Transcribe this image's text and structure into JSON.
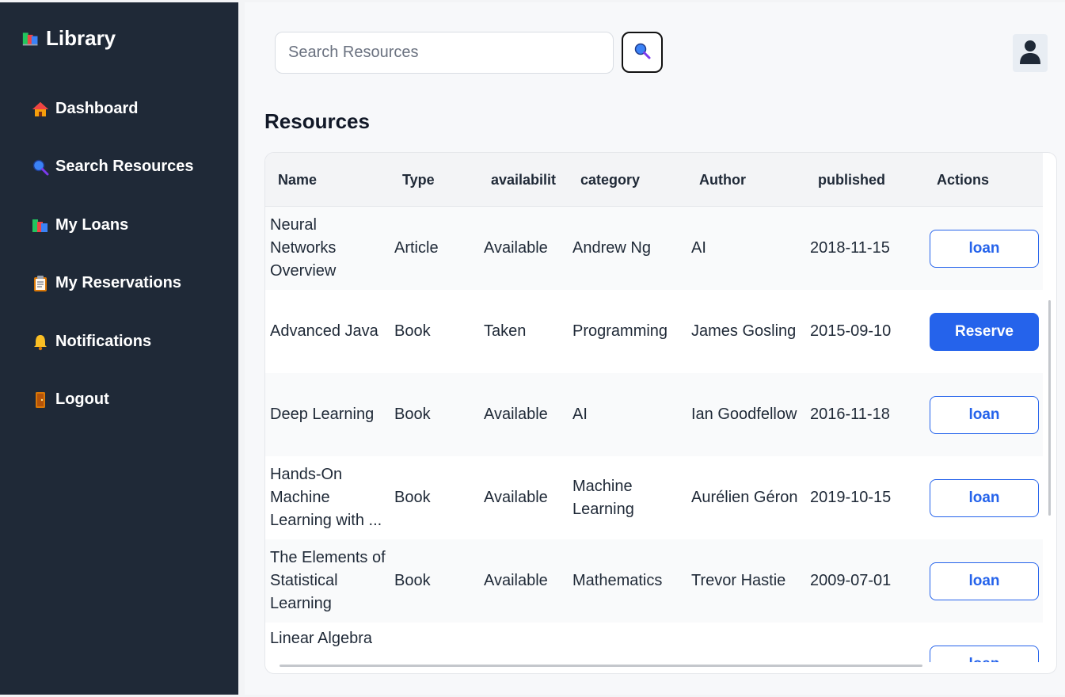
{
  "app": {
    "brand": "Library",
    "brand_icon": "books-icon"
  },
  "nav": [
    {
      "label": "Dashboard",
      "icon": "house-icon"
    },
    {
      "label": "Search Resources",
      "icon": "magnifier-icon"
    },
    {
      "label": "My Loans",
      "icon": "books-icon"
    },
    {
      "label": "My Reservations",
      "icon": "clipboard-icon"
    },
    {
      "label": "Notifications",
      "icon": "bell-icon"
    },
    {
      "label": "Logout",
      "icon": "door-icon"
    }
  ],
  "search": {
    "placeholder": "Search Resources",
    "value": ""
  },
  "page_title": "Resources",
  "table": {
    "columns": [
      "Name",
      "Type",
      "availabilit",
      "category",
      "Author",
      "published",
      "Actions"
    ],
    "rows": [
      {
        "name": [
          "Neural",
          "Networks",
          "Overview"
        ],
        "type": "Article",
        "availability": "Available",
        "category": [
          "Andrew Ng"
        ],
        "author": "AI",
        "published": "2018-11-15",
        "action": "loan"
      },
      {
        "name": [
          "Advanced Java"
        ],
        "type": "Book",
        "availability": "Taken",
        "category": [
          "Programming"
        ],
        "author": "James Gosling",
        "published": "2015-09-10",
        "action": "Reserve"
      },
      {
        "name": [
          "Deep Learning"
        ],
        "type": "Book",
        "availability": "Available",
        "category": [
          "AI"
        ],
        "author": "Ian Goodfellow",
        "published": "2016-11-18",
        "action": "loan"
      },
      {
        "name": [
          "Hands-On",
          "Machine",
          "Learning with ..."
        ],
        "type": "Book",
        "availability": "Available",
        "category": [
          "Machine",
          "Learning"
        ],
        "author": "Aurélien Géron",
        "published": "2019-10-15",
        "action": "loan"
      },
      {
        "name": [
          "The Elements of",
          "Statistical",
          "Learning"
        ],
        "type": "Book",
        "availability": "Available",
        "category": [
          "Mathematics"
        ],
        "author": "Trevor Hastie",
        "published": "2009-07-01",
        "action": "loan"
      },
      {
        "name": [
          "Linear Algebra"
        ],
        "type": "",
        "availability": "",
        "category": [
          ""
        ],
        "author": "",
        "published": "",
        "action": "loan"
      }
    ]
  },
  "colors": {
    "sidebar_bg": "#1f2937",
    "accent": "#2563eb",
    "main_bg": "#f7f8fa"
  }
}
